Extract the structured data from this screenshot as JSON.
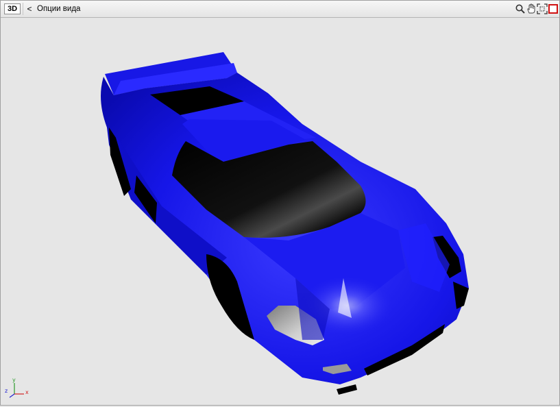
{
  "toolbar": {
    "mode_label": "3D",
    "back_glyph": "<",
    "view_options_label": "Опции вида",
    "tools": [
      "zoom-icon",
      "pan-hand-icon",
      "fit-view-icon",
      "stop-icon"
    ]
  },
  "axes": {
    "x": "x",
    "y": "y",
    "z": "z"
  },
  "colors": {
    "car_body": "#1a1aee",
    "glass": "#000000",
    "background": "#e6e6e6",
    "stop_red": "#d01010"
  }
}
